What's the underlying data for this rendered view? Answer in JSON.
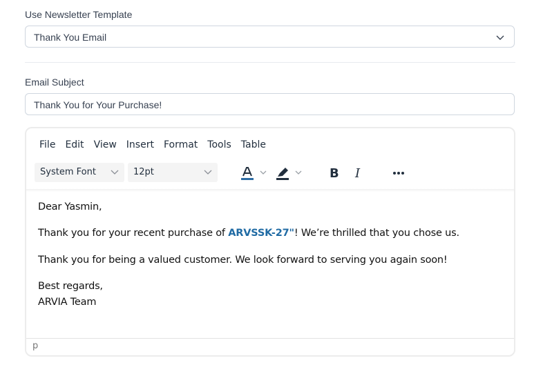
{
  "template": {
    "label": "Use Newsletter Template",
    "selected": "Thank You Email"
  },
  "subject": {
    "label": "Email Subject",
    "value": "Thank You for Your Purchase!"
  },
  "editor": {
    "menu": [
      "File",
      "Edit",
      "View",
      "Insert",
      "Format",
      "Tools",
      "Table"
    ],
    "font_family": "System Font",
    "font_size": "12pt",
    "toolbar_icons": [
      "text-color-icon",
      "highlight-color-icon",
      "bold-icon",
      "italic-icon",
      "more-icon"
    ],
    "colors": {
      "text_color_swatch": "#2e6da4",
      "highlight_swatch": "#222f3e"
    },
    "body": {
      "greeting": "Dear Yasmin,",
      "line1_before": "Thank you for your recent purchase of ",
      "line1_product": "ARVSSK-27\"",
      "line1_after": "! We’re thrilled that you chose us.",
      "line2": "Thank you for being a valued customer. We look forward to serving you again soon!",
      "closing": "Best regards,",
      "signature": "ARVIA Team"
    },
    "status_path": "p"
  }
}
